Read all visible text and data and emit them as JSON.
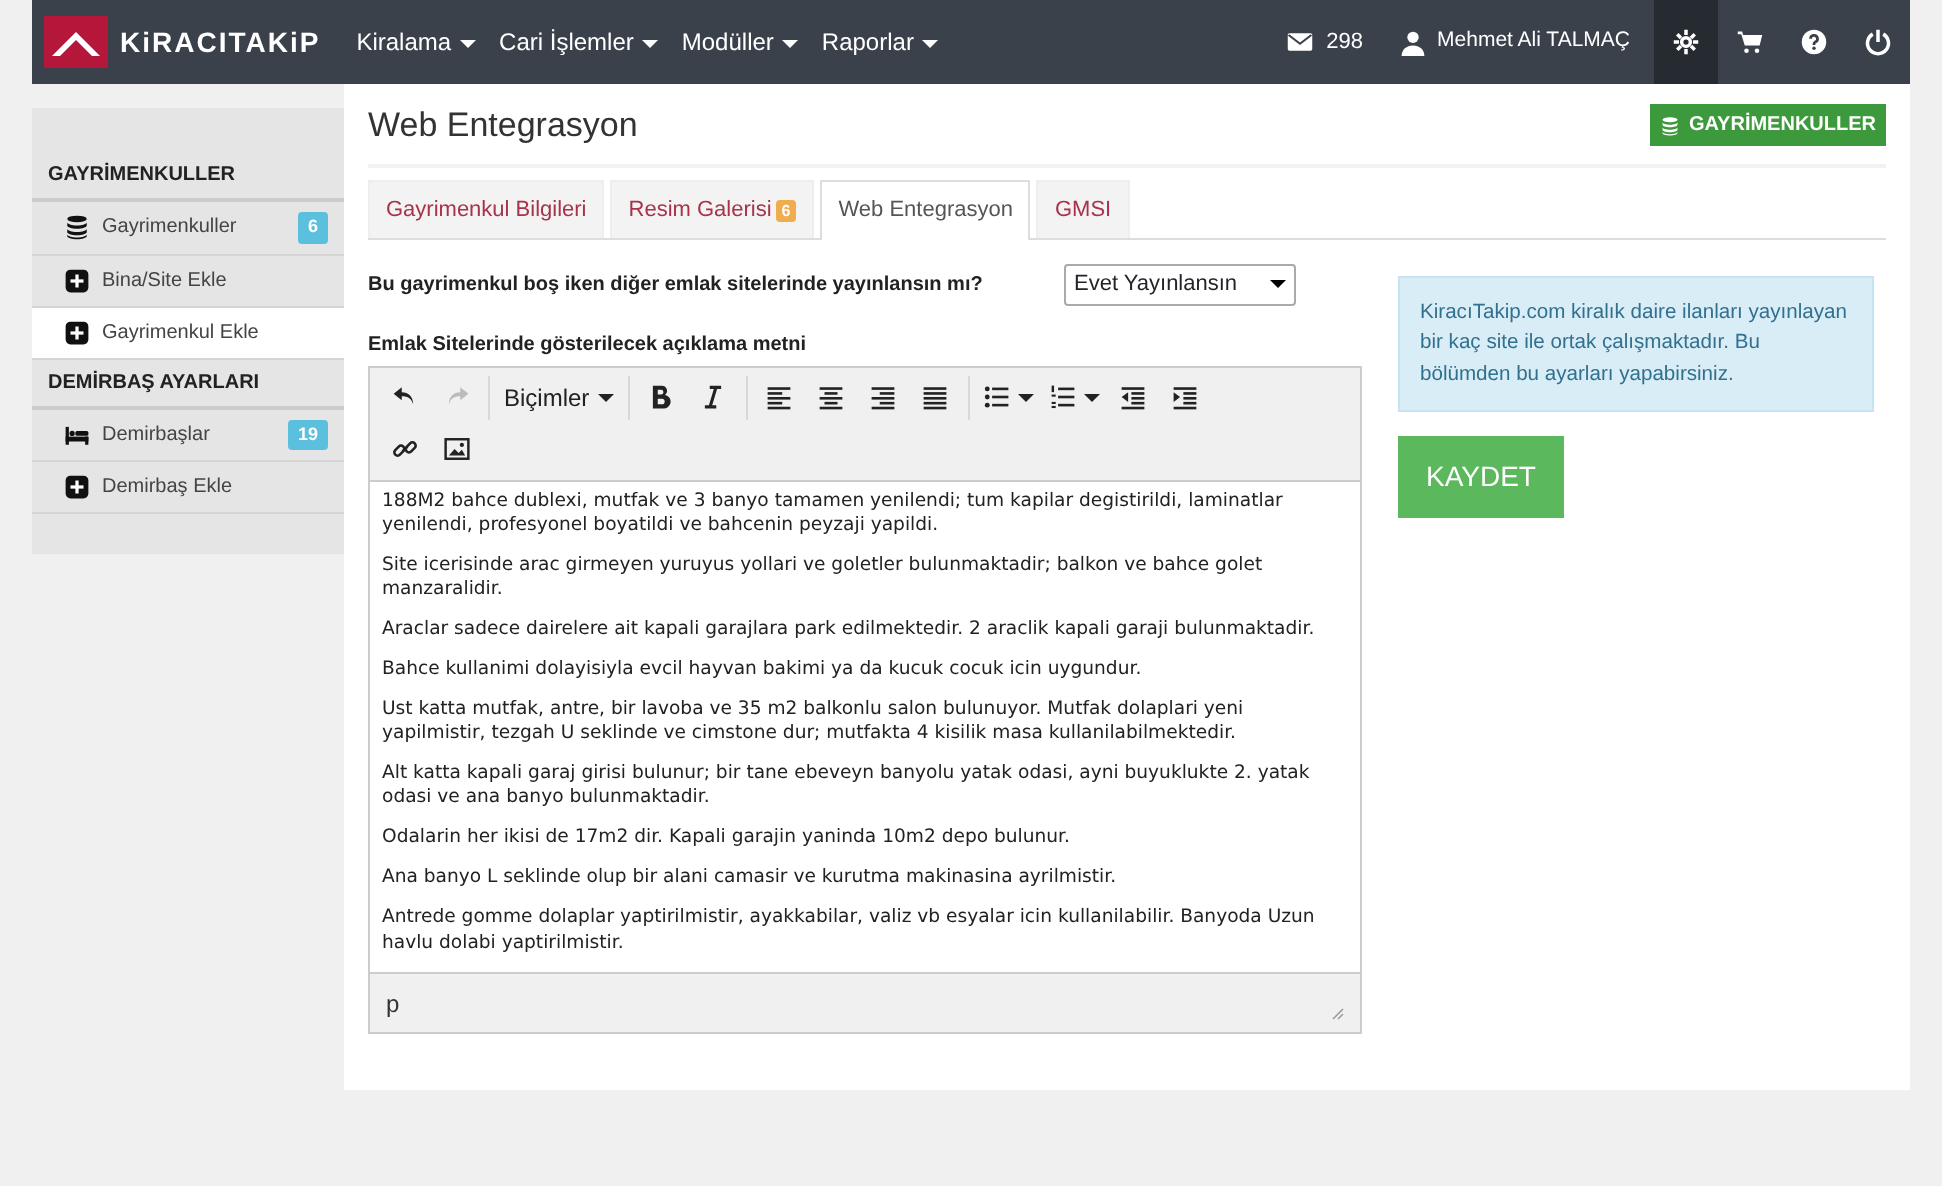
{
  "navbar": {
    "brand": "KiRACITAKiP",
    "menus": [
      {
        "label": "Kiralama"
      },
      {
        "label": "Cari İşlemler"
      },
      {
        "label": "Modüller"
      },
      {
        "label": "Raporlar"
      }
    ],
    "messages": "298",
    "user": "Mehmet Ali TALMAÇ",
    "icon_buttons": [
      {
        "kind": "gear",
        "selected": true
      },
      {
        "kind": "cart",
        "selected": false
      },
      {
        "kind": "help",
        "selected": false
      },
      {
        "kind": "power",
        "selected": false
      }
    ]
  },
  "sidebar": {
    "sections": [
      {
        "title": "GAYRİMENKULLER",
        "items": [
          {
            "kind": "database",
            "label": "Gayrimenkuller",
            "badge": "6",
            "selected": false
          },
          {
            "kind": "plus",
            "label": "Bina/Site Ekle",
            "selected": false
          },
          {
            "kind": "plus",
            "label": "Gayrimenkul Ekle",
            "selected": true
          }
        ]
      },
      {
        "title": "DEMİRBAŞ AYARLARI",
        "items": [
          {
            "kind": "bed",
            "label": "Demirbaşlar",
            "badge": "19",
            "selected": false
          },
          {
            "kind": "plus",
            "label": "Demirbaş Ekle",
            "selected": false
          }
        ]
      }
    ]
  },
  "page": {
    "title": "Web Entegrasyon",
    "header_button": "GAYRİMENKULLER"
  },
  "tabs": [
    {
      "label": "Gayrimenkul Bilgileri",
      "selected": false
    },
    {
      "label": "Resim Galerisi",
      "badge": "6",
      "selected": false
    },
    {
      "label": "Web Entegrasyon",
      "selected": true
    },
    {
      "label": "GMSI",
      "selected": false
    }
  ],
  "form": {
    "question": "Bu gayrimenkul boş iken diğer emlak sitelerinde yayınlansın mı?",
    "select_value": "Evet Yayınlansın",
    "description_label": "Emlak Sitelerinde gösterilecek açıklama metni"
  },
  "editor": {
    "formats_label": "Biçimler",
    "paragraphs": [
      "188M2 bahce dublexi, mutfak ve 3 banyo tamamen yenilendi; tum kapilar degistirildi, laminatlar yenilendi, profesyonel boyatildi ve bahcenin peyzaji yapildi.",
      "Site icerisinde arac girmeyen yuruyus yollari ve goletler bulunmaktadir; balkon ve bahce golet manzaralidir.",
      "Araclar sadece dairelere ait kapali garajlara park edilmektedir. 2 araclik kapali garaji bulunmaktadir.",
      "Bahce kullanimi dolayisiyla evcil hayvan bakimi ya da kucuk cocuk icin uygundur.",
      "Ust katta mutfak, antre, bir lavoba ve 35 m2 balkonlu salon bulunuyor. Mutfak dolaplari yeni yapilmistir, tezgah U seklinde ve cimstone dur; mutfakta 4 kisilik masa kullanilabilmektedir.",
      "Alt katta kapali garaj girisi bulunur; bir tane ebeveyn banyolu yatak odasi, ayni buyuklukte 2. yatak odasi ve ana banyo bulunmaktadir.",
      "Odalarin her ikisi de 17m2 dir. Kapali garajin yaninda 10m2 depo bulunur.",
      "Ana banyo L seklinde olup bir alani camasir ve kurutma makinasina ayrilmistir.",
      "Antrede gomme dolaplar yaptirilmistir, ayakkabilar, valiz vb esyalar icin kullanilabilir. Banyoda Uzun havlu dolabi yaptirilmistir."
    ],
    "path": "p"
  },
  "info": "KiracıTakip.com kiralık daire ilanları yayınlayan bir kaç site ile ortak çalışmaktadır. Bu bölümden bu ayarları yapabirsiniz.",
  "save_button": "KAYDET"
}
